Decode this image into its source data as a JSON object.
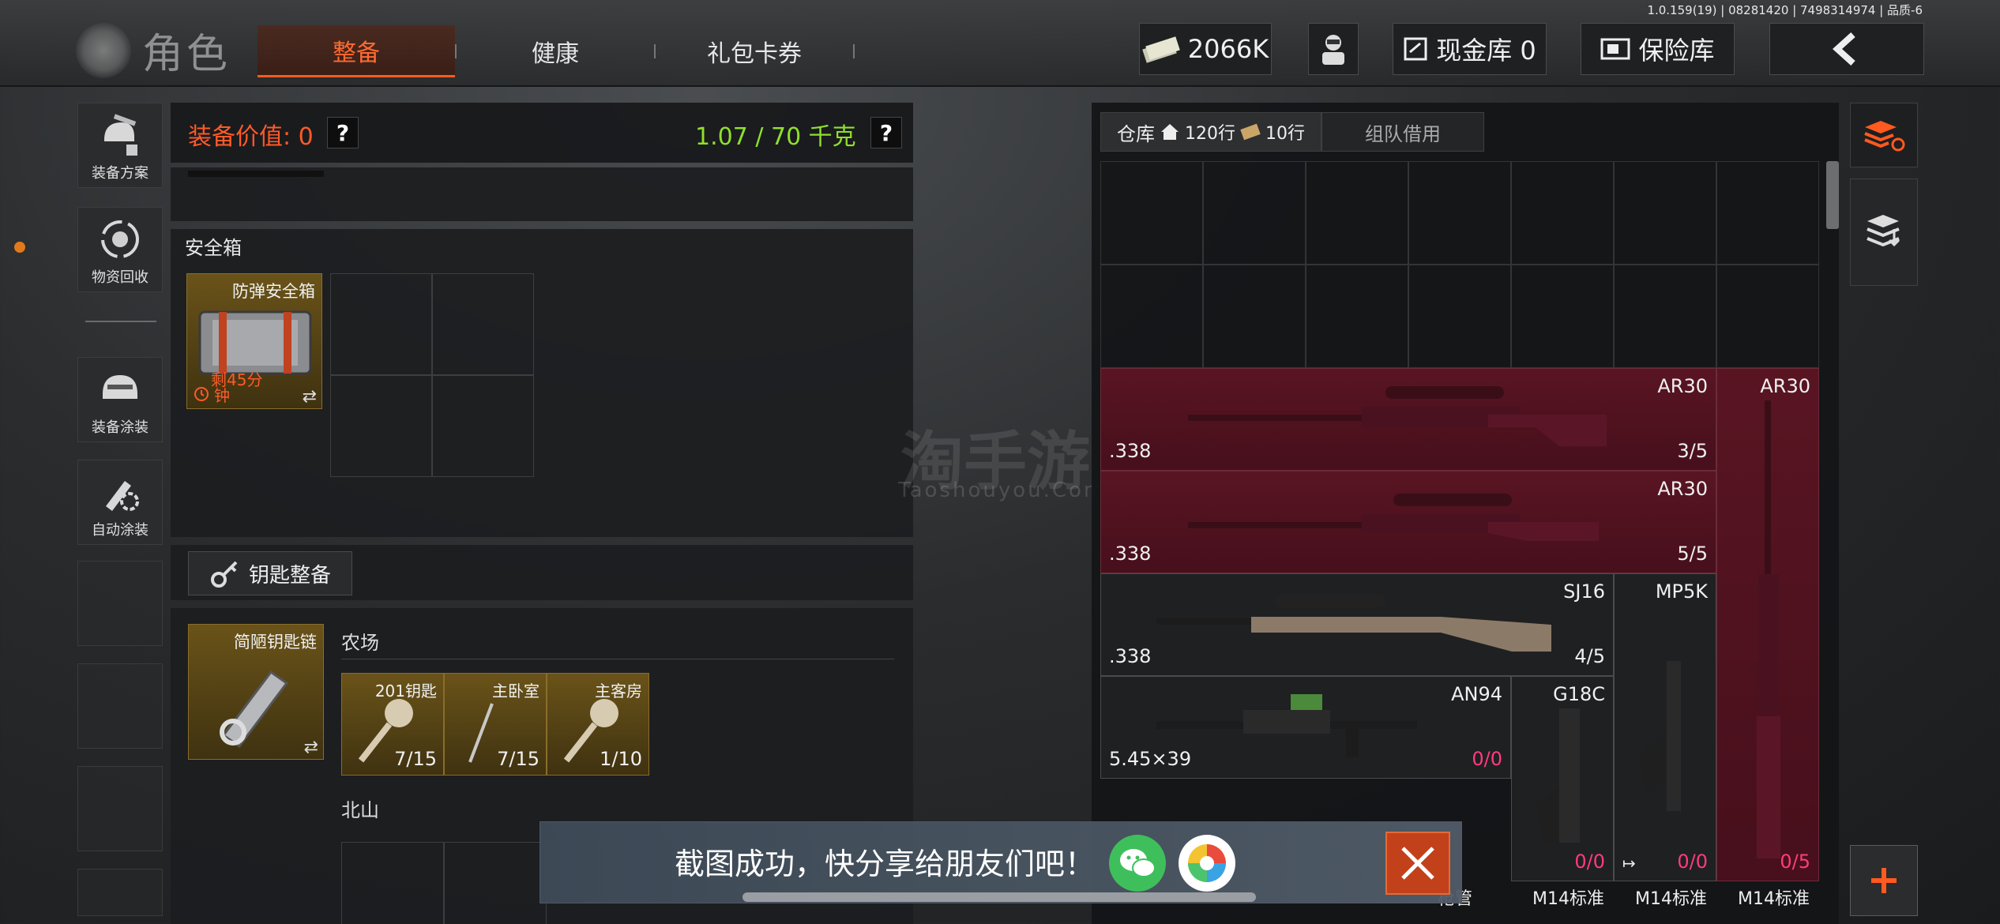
{
  "version": "1.0.159(19) | 08281420 | 7498314974 | 品质-6",
  "header": {
    "title": "角色",
    "tabs": [
      {
        "label": "整备",
        "active": true
      },
      {
        "label": "健康",
        "active": false
      },
      {
        "label": "礼包卡券",
        "active": false
      }
    ],
    "money": "2066K",
    "cash_vault": "现金库 0",
    "insurance": "保险库"
  },
  "sidebar": {
    "items": [
      {
        "label": "装备方案",
        "icon": "helmet-gun-icon"
      },
      {
        "label": "物资回收",
        "icon": "recycle-icon"
      },
      {
        "label": "装备涂装",
        "icon": "paint-helmet-icon"
      },
      {
        "label": "自动涂装",
        "icon": "auto-paint-icon"
      }
    ]
  },
  "equipment": {
    "value_label": "装备价值: 0",
    "weight_label": "1.07 / 70 千克",
    "help": "?"
  },
  "safe_box": {
    "title": "安全箱",
    "item_name": "防弹安全箱",
    "item_timer": "钟",
    "item_timer_prefix": "剩45分"
  },
  "keys": {
    "button_label": "钥匙整备",
    "chain_name": "简陋钥匙链",
    "sections": [
      {
        "name": "农场",
        "keys": [
          {
            "name": "201钥匙",
            "count": "7/15"
          },
          {
            "name": "主卧室",
            "count": "7/15"
          },
          {
            "name": "主客房",
            "count": "1/10"
          }
        ]
      },
      {
        "name": "北山",
        "keys": []
      }
    ]
  },
  "warehouse": {
    "tab_label": "仓库",
    "rows": "120行",
    "extra_rows": "10行",
    "team_tab": "组队借用",
    "guns": [
      {
        "name": "AR30",
        "ammo": ".338",
        "durability": "3/5",
        "status": "red"
      },
      {
        "name": "AR30",
        "ammo": ".338",
        "durability": "5/5",
        "status": "red"
      },
      {
        "name": "SJ16",
        "ammo": ".338",
        "durability": "4/5",
        "status": "normal"
      },
      {
        "name": "AN94",
        "ammo": "5.45×39",
        "durability": "0/0",
        "status": "normal"
      },
      {
        "name": "G18C",
        "ammo": "",
        "durability": "0/0",
        "status": "normal"
      },
      {
        "name": "MP5K",
        "ammo": "",
        "durability": "0/0",
        "status": "normal"
      },
      {
        "name": "AR30",
        "ammo": "",
        "durability": "0/5",
        "status": "red"
      }
    ],
    "bottom_labels": [
      "枪管",
      "M14标准",
      "M14标准",
      "M14标准"
    ]
  },
  "toast": {
    "message": "截图成功，快分享给朋友们吧！"
  },
  "watermark": {
    "main": "淘手游",
    "sub": "Taoshouyou.Com"
  },
  "colors": {
    "accent": "#ff5a1f",
    "green": "#8fe02a",
    "pink": "#ff3c7a",
    "locked_red": "#5f1423",
    "wechat": "#3fbf5b"
  }
}
